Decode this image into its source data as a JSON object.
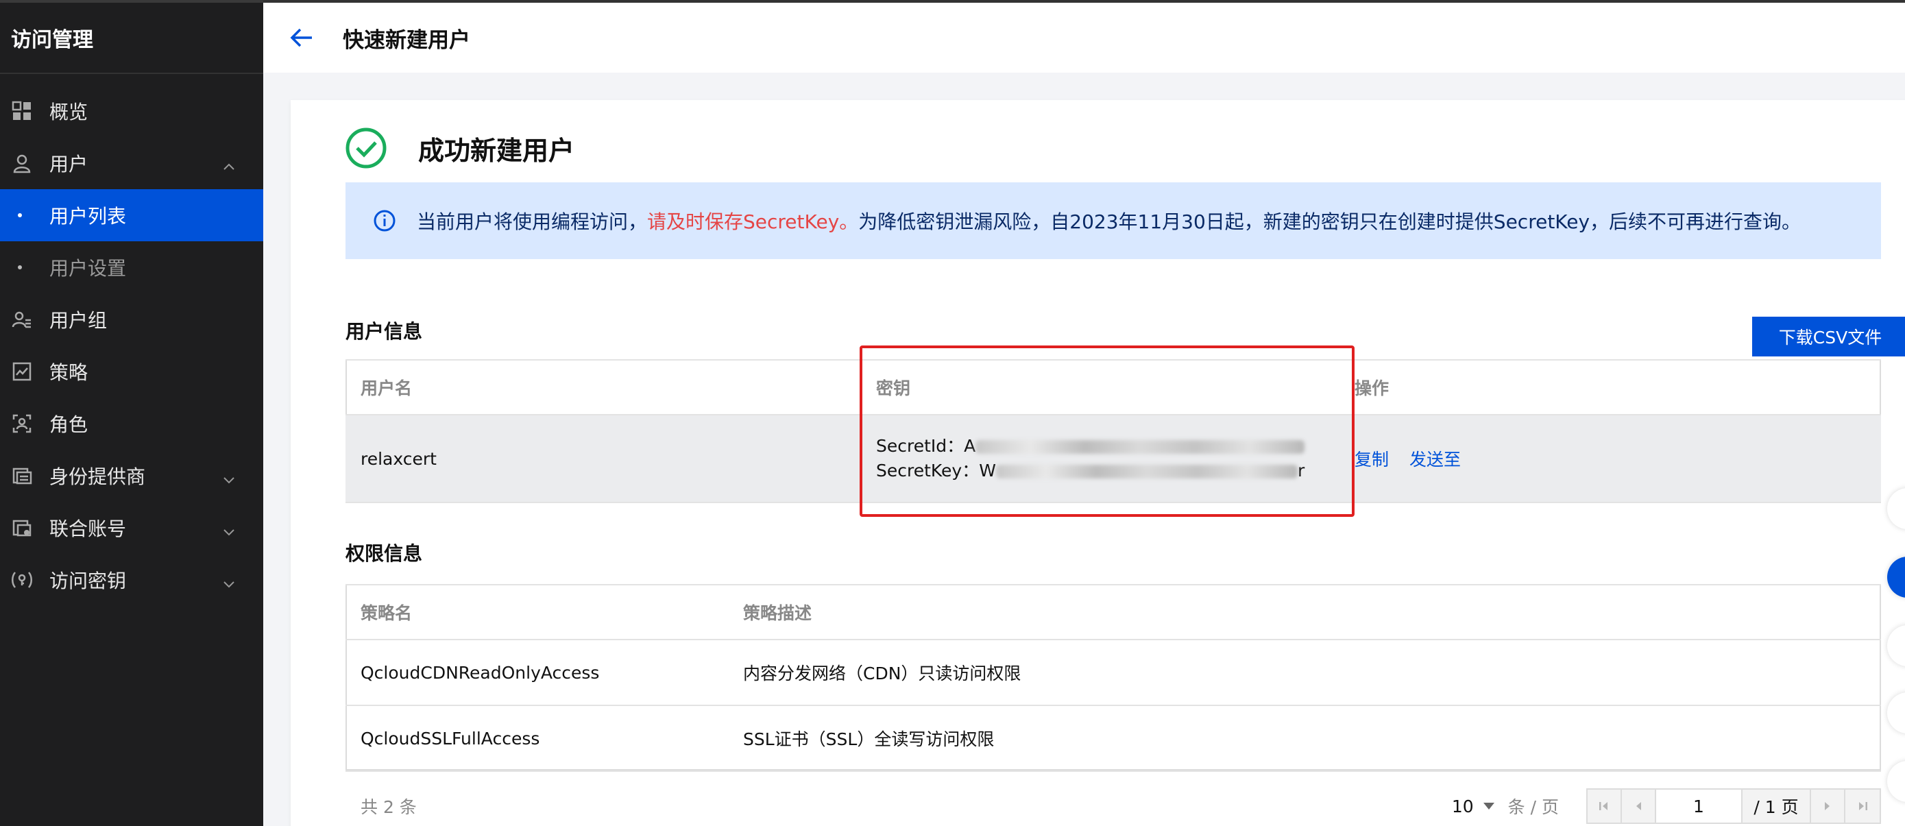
{
  "sidebar": {
    "title": "访问管理",
    "items": [
      {
        "label": "概览",
        "icon": "dashboard-icon"
      },
      {
        "label": "用户",
        "icon": "user-icon"
      },
      {
        "label": "用户列表"
      },
      {
        "label": "用户设置"
      },
      {
        "label": "用户组",
        "icon": "user-group-icon"
      },
      {
        "label": "策略",
        "icon": "policy-icon"
      },
      {
        "label": "角色",
        "icon": "role-icon"
      },
      {
        "label": "身份提供商",
        "icon": "identity-provider-icon"
      },
      {
        "label": "联合账号",
        "icon": "federated-account-icon"
      },
      {
        "label": "访问密钥",
        "icon": "access-key-icon"
      }
    ]
  },
  "header": {
    "title": "快速新建用户"
  },
  "success": {
    "title": "成功新建用户"
  },
  "notice": {
    "part1": "当前用户将使用编程访问，",
    "highlight": "请及时保存SecretKey。",
    "part2": "为降低密钥泄漏风险，自2023年11月30日起，新建的密钥只在创建时提供SecretKey，后续不可再进行查询。"
  },
  "user_info": {
    "section_title": "用户信息",
    "download_label": "下载CSV文件",
    "columns": [
      "用户名",
      "密钥",
      "操作"
    ],
    "row": {
      "username": "relaxcert",
      "secret_id_label": "SecretId：",
      "secret_id_prefix": "A",
      "secret_key_label": "SecretKey：",
      "secret_key_prefix": "W",
      "secret_key_suffix": "r",
      "actions": [
        "复制",
        "发送至"
      ]
    }
  },
  "permissions": {
    "section_title": "权限信息",
    "columns": [
      "策略名",
      "策略描述"
    ],
    "rows": [
      {
        "name": "QcloudCDNReadOnlyAccess",
        "desc": "内容分发网络（CDN）只读访问权限"
      },
      {
        "name": "QcloudSSLFullAccess",
        "desc": "SSL证书（SSL）全读写访问权限"
      }
    ]
  },
  "pager": {
    "total": "共 2 条",
    "page_size": "10",
    "page_size_unit": "条 / 页",
    "current_page": "1",
    "total_pages": "/ 1 页"
  },
  "colors": {
    "primary": "#0052d9",
    "highlight_red": "#e54545",
    "sidebar_bg": "#1e1e1f",
    "notice_bg": "#d9e8ff"
  }
}
